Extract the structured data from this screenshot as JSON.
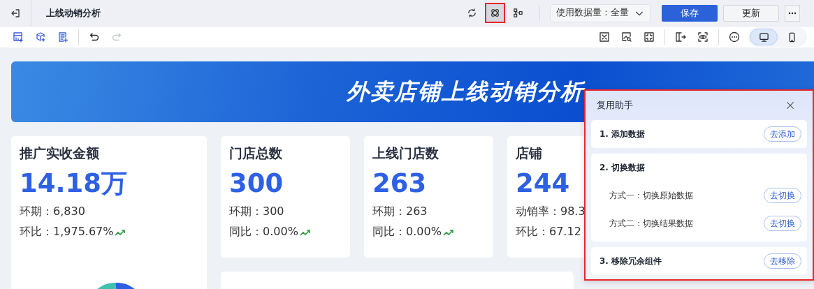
{
  "app_bar": {
    "title": "上线动销分析",
    "tools": [
      {
        "kind": "refresh",
        "selected": false
      },
      {
        "kind": "reuse",
        "selected": true
      },
      {
        "kind": "flow",
        "selected": false
      }
    ],
    "data_scope": "使用数据量：全量",
    "buttons": [
      {
        "label": "保存",
        "kind": "primary"
      },
      {
        "label": "更新",
        "kind": "default"
      }
    ]
  },
  "toolbar": {
    "redo_disabled": true,
    "devices": [
      {
        "kind": "desktop",
        "selected": true
      },
      {
        "kind": "mobile",
        "selected": false
      }
    ]
  },
  "banner": {
    "title": "外卖店铺上线动销分析"
  },
  "kpis": [
    {
      "title": "推广实收金额",
      "value": "14.18万",
      "lines": [
        {
          "text": "环期：6,830",
          "trend_up": false
        },
        {
          "text": "环比：1,975.67%",
          "trend_up": true
        }
      ]
    },
    {
      "title": "门店总数",
      "value": "300",
      "lines": [
        {
          "text": "环期：300",
          "trend_up": false
        },
        {
          "text": "同比：0.00%",
          "trend_up": true
        }
      ]
    },
    {
      "title": "上线门店数",
      "value": "263",
      "lines": [
        {
          "text": "环期：263",
          "trend_up": false
        },
        {
          "text": "同比：0.00%",
          "trend_up": true
        }
      ]
    },
    {
      "title": "店铺",
      "value": "244",
      "lines": [
        {
          "text": "动销率：98.3"
        },
        {
          "text": "环比：67.12"
        }
      ]
    }
  ],
  "assistant": {
    "title": "复用助手",
    "sections": [
      {
        "title": "1. 添加数据",
        "action": "去添加"
      },
      {
        "title": "2. 切换数据",
        "options": [
          {
            "label": "方式一：切换原始数据",
            "action": "去切换"
          },
          {
            "label": "方式二：切换结果数据",
            "action": "去切换"
          }
        ]
      },
      {
        "title": "3. 移除冗余组件",
        "action": "去移除"
      }
    ]
  }
}
